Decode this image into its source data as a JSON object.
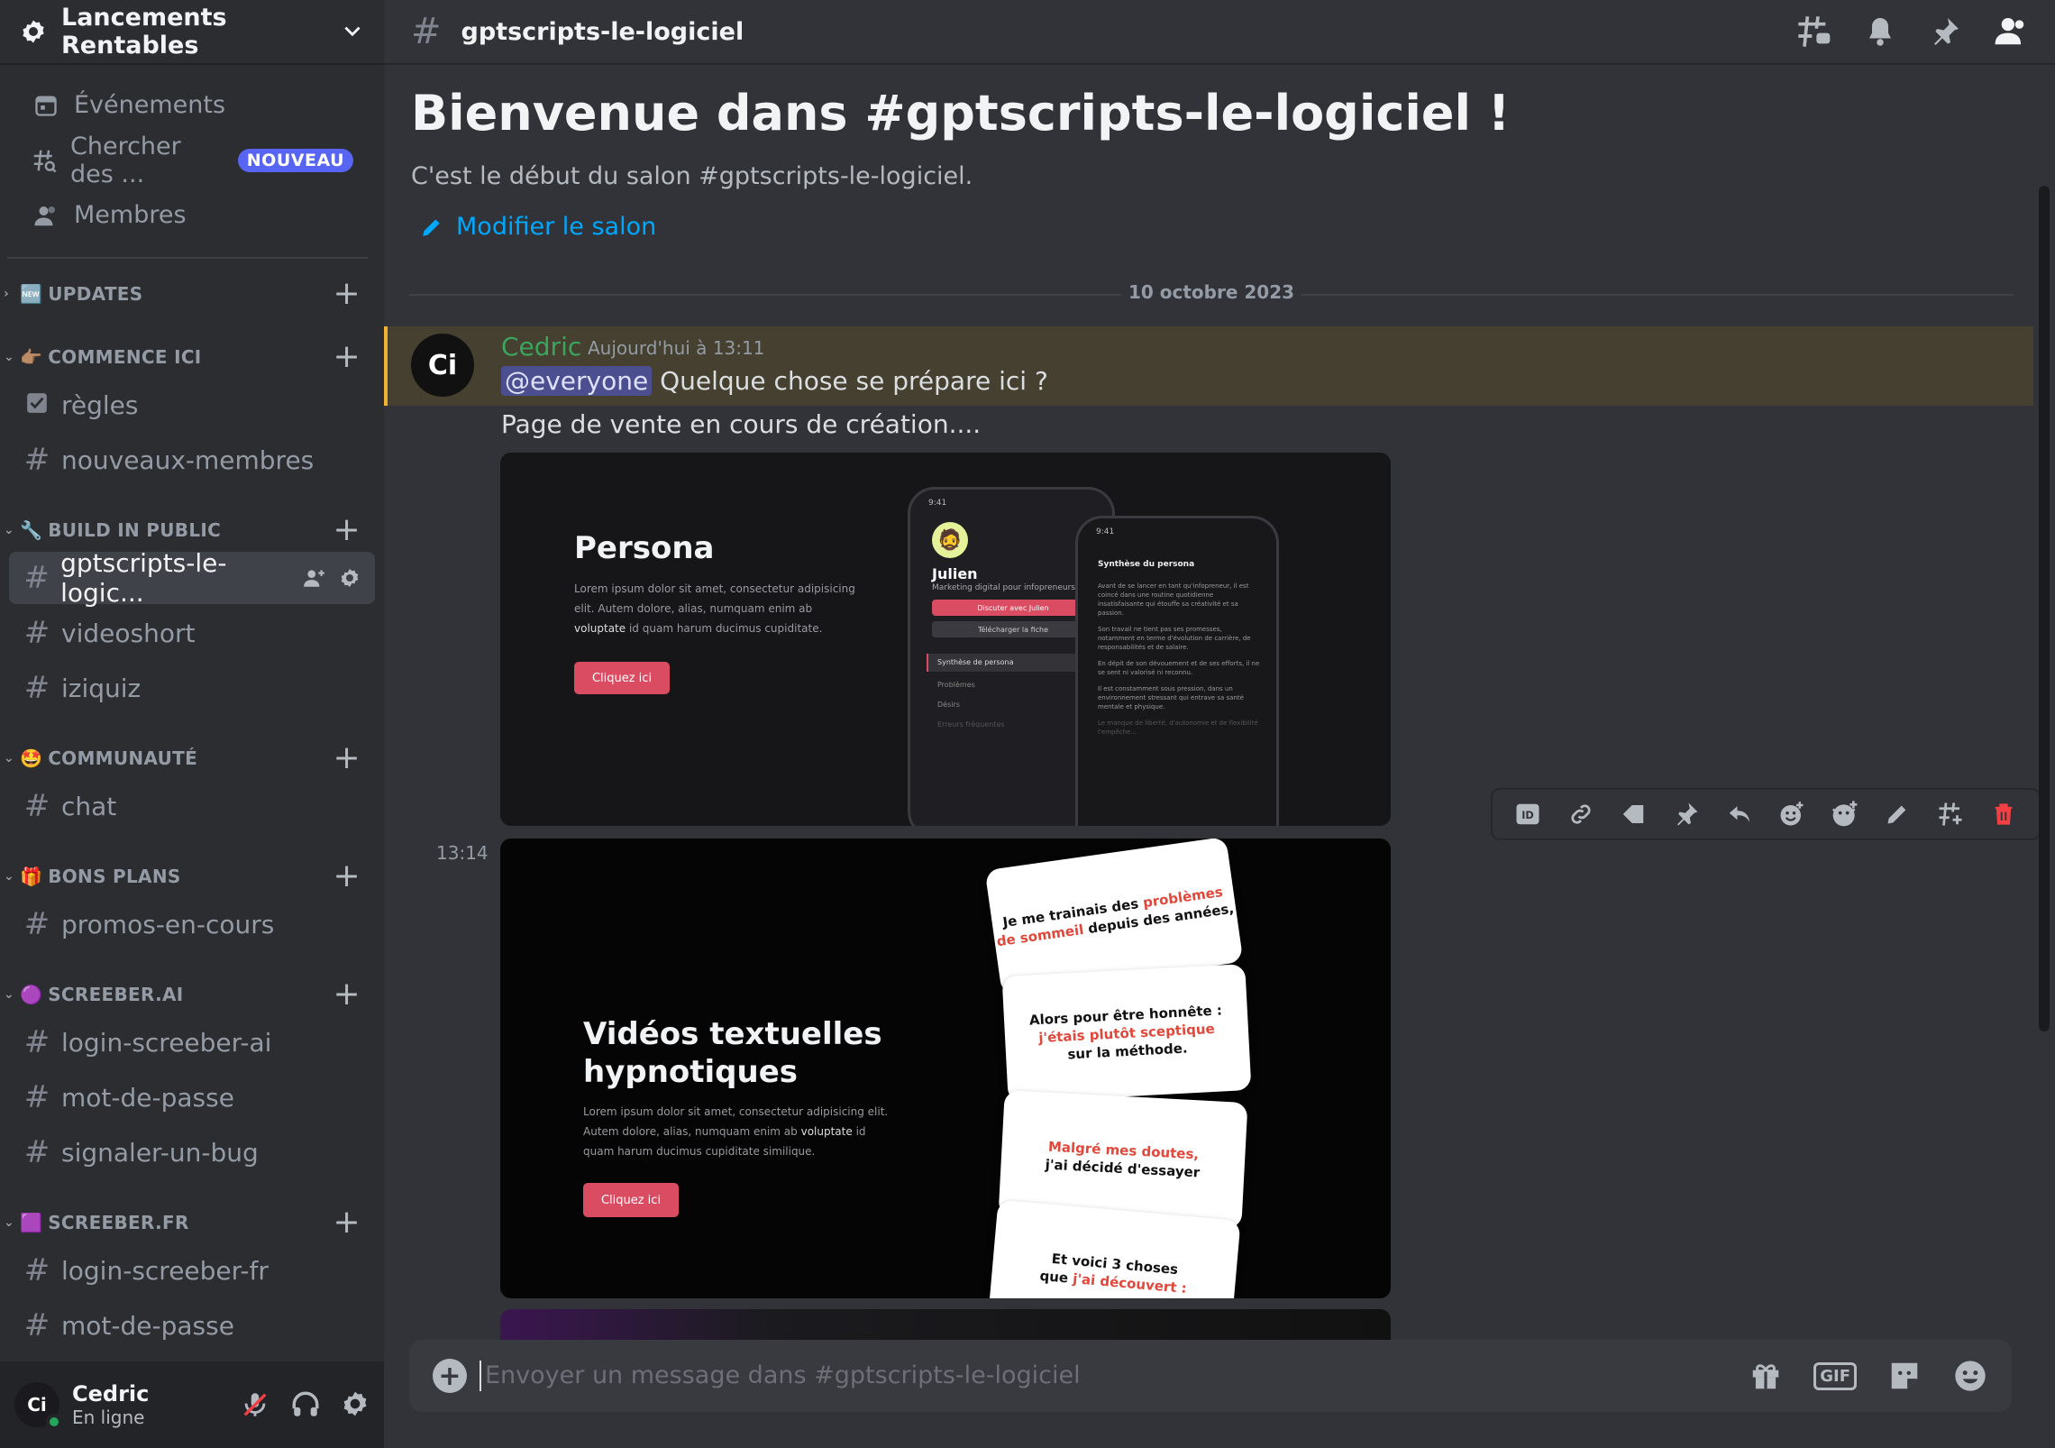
{
  "server": {
    "name": "Lancements Rentables"
  },
  "top_items": [
    {
      "label": "Événements",
      "icon": "calendar-icon"
    },
    {
      "label": "Chercher des ...",
      "icon": "channel-browse-icon",
      "badge": "NOUVEAU"
    },
    {
      "label": "Membres",
      "icon": "members-icon"
    }
  ],
  "categories": {
    "updates": {
      "emoji": "🆕",
      "label": "UPDATES"
    },
    "commence": {
      "emoji": "👉🏽",
      "label": "COMMENCE ICI",
      "channels": [
        "règles",
        "nouveaux-membres"
      ]
    },
    "build": {
      "emoji": "🔧",
      "label": "BUILD IN PUBLIC",
      "channels": [
        "gptscripts-le-logic...",
        "videoshort",
        "iziquiz"
      ]
    },
    "communaute": {
      "emoji": "🤩",
      "label": "COMMUNAUTÉ",
      "channels": [
        "chat"
      ]
    },
    "bons_plans": {
      "emoji": "🎁",
      "label": "BONS PLANS",
      "channels": [
        "promos-en-cours"
      ]
    },
    "screeber_ai": {
      "emoji": "🟣",
      "label": "SCREEBER.AI",
      "channels": [
        "login-screeber-ai",
        "mot-de-passe",
        "signaler-un-bug"
      ]
    },
    "screeber_fr": {
      "emoji": "🟪",
      "label": "SCREEBER.FR",
      "channels": [
        "login-screeber-fr",
        "mot-de-passe"
      ]
    }
  },
  "user": {
    "name": "Cedric",
    "status": "En ligne",
    "avatar_text": "Ci"
  },
  "channel": {
    "name": "gptscripts-le-logiciel",
    "welcome_title": "Bienvenue dans #gptscripts-le-logiciel !",
    "welcome_sub": "C'est le début du salon #gptscripts-le-logiciel.",
    "edit_label": "Modifier le salon"
  },
  "date_divider": "10 octobre 2023",
  "message": {
    "author": "Cedric",
    "timestamp": "Aujourd'hui à 13:11",
    "mention": "@everyone",
    "text1": " Quelque chose se prépare ici ?",
    "text2": "Page de vente en cours de création....",
    "side_time": "13:14"
  },
  "attachment1": {
    "title": "Persona",
    "lorem": "Lorem ipsum dolor sit amet, consectetur adipisicing elit. Autem dolore, alias, numquam enim ab",
    "lorem_bold": "voluptate",
    "lorem_end": " id quam harum ducimus cupiditate.",
    "cta": "Cliquez ici",
    "phone1": {
      "time": "9:41",
      "name": "Julien",
      "role": "Marketing digital pour infopreneurs",
      "btn1": "Discuter avec Julien",
      "btn2": "Télécharger la fiche",
      "menu": [
        "Synthèse de persona",
        "Problèmes",
        "Désirs",
        "Erreurs fréquentes"
      ]
    },
    "phone2": {
      "time": "9:41",
      "heading": "Synthèse du persona",
      "paras": [
        "Avant de se lancer en tant qu'infopreneur, il est coincé dans une routine quotidienne insatisfaisante qui étouffe sa créativité et sa passion.",
        "Son travail ne tient pas ses promesses, notamment en terme d'évolution de carrière, de responsabilités et de salaire.",
        "En dépit de son dévouement et de ses efforts, il ne se sent ni valorisé ni reconnu.",
        "Il est constamment sous pression, dans un environnement stressant qui entrave sa santé mentale et physique.",
        "Le manque de liberté, d'autonomie et de flexibilité l'empêche..."
      ]
    }
  },
  "attachment2": {
    "title_line1": "Vidéos textuelles",
    "title_line2": "hypnotiques",
    "lorem": "Lorem ipsum dolor sit amet, consectetur adipisicing elit. Autem dolore, alias, numquam enim ab",
    "lorem_bold": "voluptate",
    "lorem_end": " id quam harum ducimus cupiditate similique.",
    "cta": "Cliquez ici",
    "cards": [
      {
        "pre": "Je me trainais des ",
        "red": "problèmes de sommeil",
        "post": " depuis des années,"
      },
      {
        "pre": "Alors pour être honnête :",
        "red": "j'étais plutôt sceptique",
        "post": "sur la méthode."
      },
      {
        "pre": "",
        "red": "Malgré mes doutes,",
        "post": "j'ai décidé d'essayer"
      },
      {
        "pre": "Et voici 3 choses",
        "red": "j'ai découvert :",
        "post": "que "
      }
    ]
  },
  "composer": {
    "placeholder": "Envoyer un message dans #gptscripts-le-logiciel",
    "gif": "GIF"
  },
  "colors": {
    "accent": "#5865f2",
    "link": "#00a8fc",
    "online": "#23a55a",
    "mention_bg": "#45402f",
    "author": "#3ba55d",
    "cta": "#d94c62"
  }
}
